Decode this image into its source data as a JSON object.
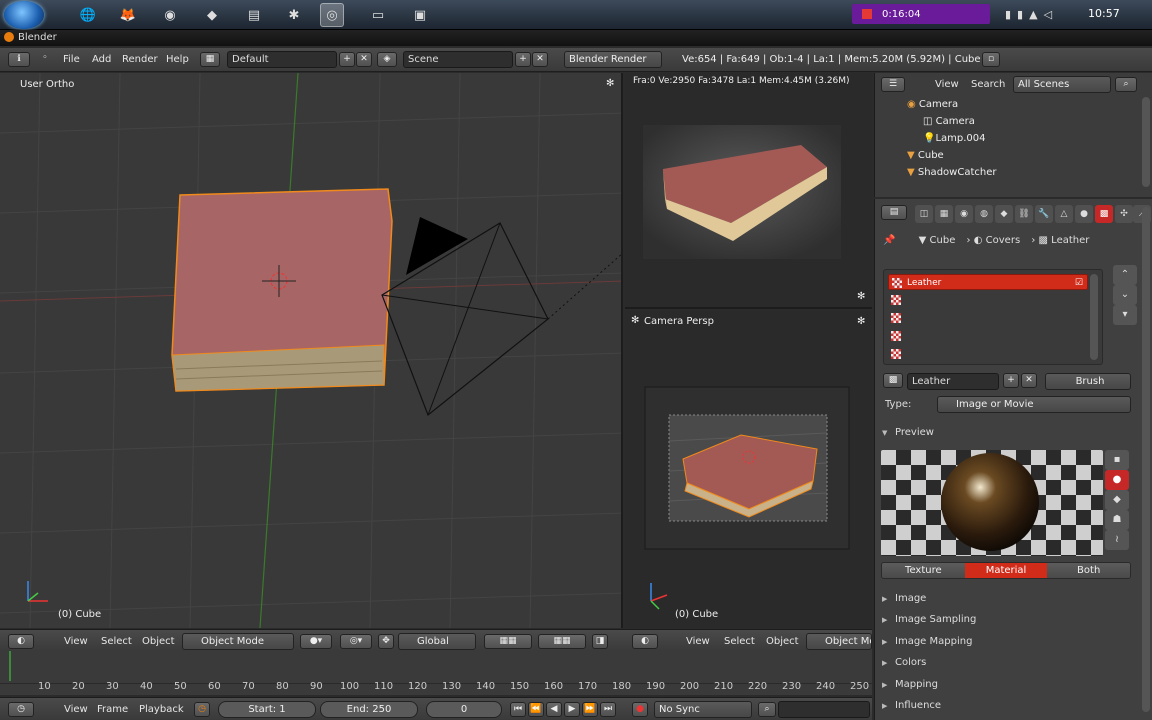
{
  "taskbar": {
    "recorder_time": "0:16:04",
    "clock": "10:57"
  },
  "window": {
    "title": "Blender"
  },
  "info_header": {
    "menus": [
      "File",
      "Add",
      "Render",
      "Help"
    ],
    "screen_layout": "Default",
    "scene": "Scene",
    "render_engine": "Blender Render",
    "stats": "Ve:654 | Fa:649 | Ob:1-4 | La:1 | Mem:5.20M (5.92M) | Cube"
  },
  "viewport": {
    "view_label": "User Ortho",
    "object_label": "(0) Cube"
  },
  "render_preview": {
    "stats": "Fra:0  Ve:2950 Fa:3478 La:1 Mem:4.45M (3.26M)"
  },
  "camera_view": {
    "view_label": "Camera Persp",
    "object_label": "(0) Cube"
  },
  "outliner": {
    "menus": [
      "View",
      "Search"
    ],
    "filter": "All Scenes",
    "rows": [
      {
        "label": "Camera"
      },
      {
        "label": "Camera"
      },
      {
        "label": "Lamp.004"
      },
      {
        "label": "Cube"
      },
      {
        "label": "ShadowCatcher"
      }
    ]
  },
  "properties": {
    "breadcrumb": [
      "Cube",
      "Covers",
      "Leather"
    ],
    "slots": [
      "Leather",
      "",
      "",
      "",
      ""
    ],
    "texture_name": "Leather",
    "brush_label": "Brush",
    "type_label": "Type:",
    "type_value": "Image or Movie",
    "preview_label": "Preview",
    "preview_modes": [
      "Texture",
      "Material",
      "Both"
    ],
    "active_mode": "Material",
    "sections": [
      "Image",
      "Image Sampling",
      "Image Mapping",
      "Colors",
      "Mapping",
      "Influence"
    ]
  },
  "timeline_header": {
    "menus": [
      "View",
      "Select",
      "Object"
    ],
    "mode": "Object Mode",
    "orientation": "Global",
    "right_menus": [
      "View",
      "Select",
      "Object"
    ],
    "right_mode": "Object Mo"
  },
  "timeline": {
    "ticks": [
      "10",
      "20",
      "30",
      "40",
      "50",
      "60",
      "70",
      "80",
      "90",
      "100",
      "110",
      "120",
      "130",
      "140",
      "150",
      "160",
      "170",
      "180",
      "190",
      "200",
      "210",
      "220",
      "230",
      "240",
      "250"
    ]
  },
  "playback": {
    "menus": [
      "View",
      "Frame",
      "Playback"
    ],
    "start": "Start: 1",
    "end": "End: 250",
    "current": "0",
    "sync": "No Sync"
  }
}
